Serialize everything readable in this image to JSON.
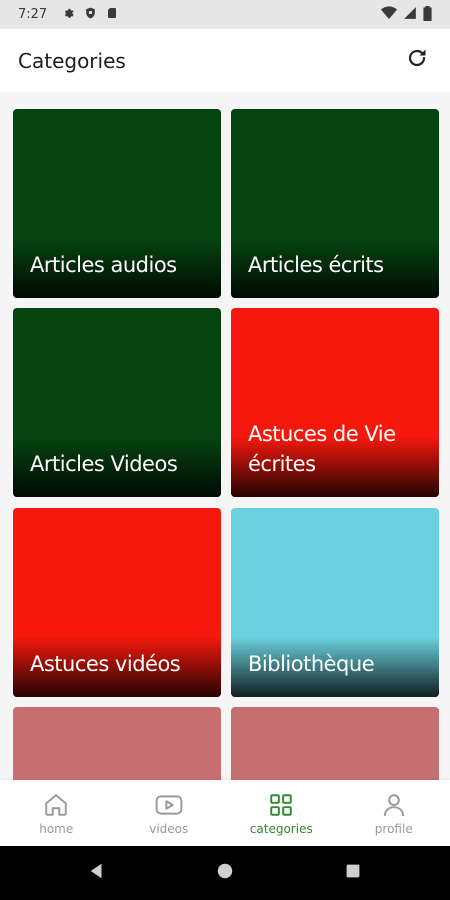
{
  "status_bar": {
    "time": "7:27"
  },
  "app_bar": {
    "title": "Categories"
  },
  "categories": [
    {
      "label": "Articles audios",
      "color": "#054411"
    },
    {
      "label": "Articles écrits",
      "color": "#054411"
    },
    {
      "label": "Articles Videos",
      "color": "#054411"
    },
    {
      "label": "Astuces de Vie écrites",
      "color": "#f5180c"
    },
    {
      "label": "Astuces vidéos",
      "color": "#f5180c"
    },
    {
      "label": "Bibliothèque",
      "color": "#6bd1de"
    },
    {
      "label": "",
      "color": "#c66f70"
    },
    {
      "label": "",
      "color": "#c66f70"
    }
  ],
  "bottom_nav": {
    "items": [
      {
        "label": "home",
        "icon": "home-icon"
      },
      {
        "label": "videos",
        "icon": "video-icon"
      },
      {
        "label": "categories",
        "icon": "grid-icon",
        "active": true
      },
      {
        "label": "profile",
        "icon": "person-icon"
      }
    ],
    "active_color": "#2e8a2e",
    "inactive_color": "#9a9a9a"
  }
}
